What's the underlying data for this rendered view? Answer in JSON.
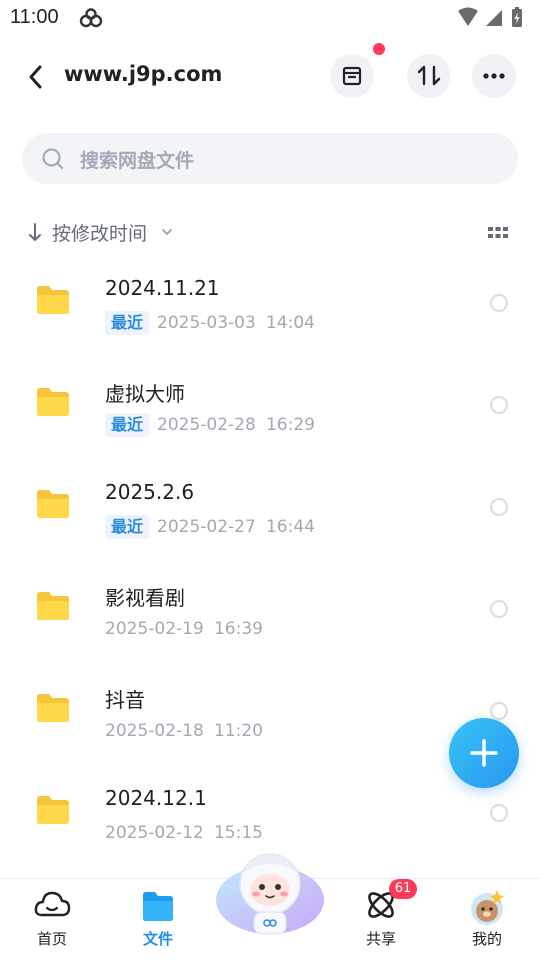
{
  "status_bar": {
    "time": "11:00"
  },
  "header": {
    "title": "www.j9p.com"
  },
  "search": {
    "placeholder": "搜索网盘文件"
  },
  "sort": {
    "label": "按修改时间"
  },
  "files": [
    {
      "name": "2024.11.21",
      "tag": "最近",
      "date": "2025-03-03",
      "time": "14:04"
    },
    {
      "name": "虚拟大师",
      "tag": "最近",
      "date": "2025-02-28",
      "time": "16:29"
    },
    {
      "name": "2025.2.6",
      "tag": "最近",
      "date": "2025-02-27",
      "time": "16:44"
    },
    {
      "name": "影视看剧",
      "tag": "",
      "date": "2025-02-19",
      "time": "16:39"
    },
    {
      "name": "抖音",
      "tag": "",
      "date": "2025-02-18",
      "time": "11:20"
    },
    {
      "name": "2024.12.1",
      "tag": "",
      "date": "2025-02-12",
      "time": "15:15"
    }
  ],
  "nav": {
    "items": [
      {
        "label": "首页",
        "icon": "cloud-home-icon",
        "active": false
      },
      {
        "label": "文件",
        "icon": "folder-icon",
        "active": true
      },
      {
        "label": "共享",
        "icon": "share-atom-icon",
        "active": false,
        "badge": "61"
      },
      {
        "label": "我的",
        "icon": "avatar-icon",
        "active": false
      }
    ]
  },
  "colors": {
    "accent": "#1d8df0",
    "folder": "#ffd84a",
    "badge": "#ff3a59",
    "fab": "#2796ee",
    "tag_text": "#2a8cdc"
  }
}
